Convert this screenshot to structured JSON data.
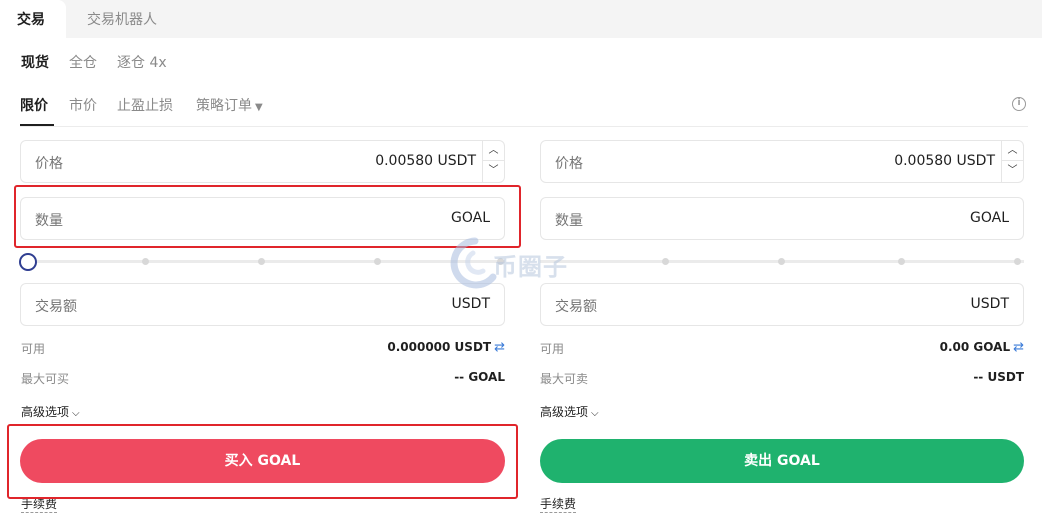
{
  "tabs": {
    "active": "交易",
    "inactive": "交易机器人"
  },
  "margin_modes": {
    "spot": "现货",
    "cross": "全仓",
    "isolated": "逐仓 4x"
  },
  "order_types": {
    "limit": "限价",
    "market": "市价",
    "tpsl": "止盈止损",
    "strategy": "策略订单"
  },
  "buy": {
    "price_label": "价格",
    "price_value": "0.00580 USDT",
    "qty_label": "数量",
    "qty_unit": "GOAL",
    "slider_percent": 0,
    "amount_label": "交易额",
    "amount_unit": "USDT",
    "available_label": "可用",
    "available_value": "0.000000 USDT",
    "max_label": "最大可买",
    "max_value": "-- GOAL",
    "advanced_label": "高级选项",
    "button_label": "买入 GOAL",
    "fee_label": "手续费"
  },
  "sell": {
    "price_label": "价格",
    "price_value": "0.00580 USDT",
    "qty_label": "数量",
    "qty_unit": "GOAL",
    "slider_percent": 0,
    "amount_label": "交易额",
    "amount_unit": "USDT",
    "available_label": "可用",
    "available_value": "0.00 GOAL",
    "max_label": "最大可卖",
    "max_value": "-- USDT",
    "advanced_label": "高级选项",
    "button_label": "卖出 GOAL",
    "fee_label": "手续费"
  },
  "watermark_text": "币圈子",
  "icons": {
    "info": "info-icon",
    "swap": "swap-icon",
    "chevron_down": "chevron-down-icon",
    "stepper_up": "chevron-up-icon",
    "stepper_down": "chevron-down-icon"
  },
  "colors": {
    "buy": "#ef4a60",
    "sell": "#1fb26e",
    "highlight": "#e0252b",
    "swap": "#3b7bd8",
    "slider_handle": "#2f3e91"
  }
}
